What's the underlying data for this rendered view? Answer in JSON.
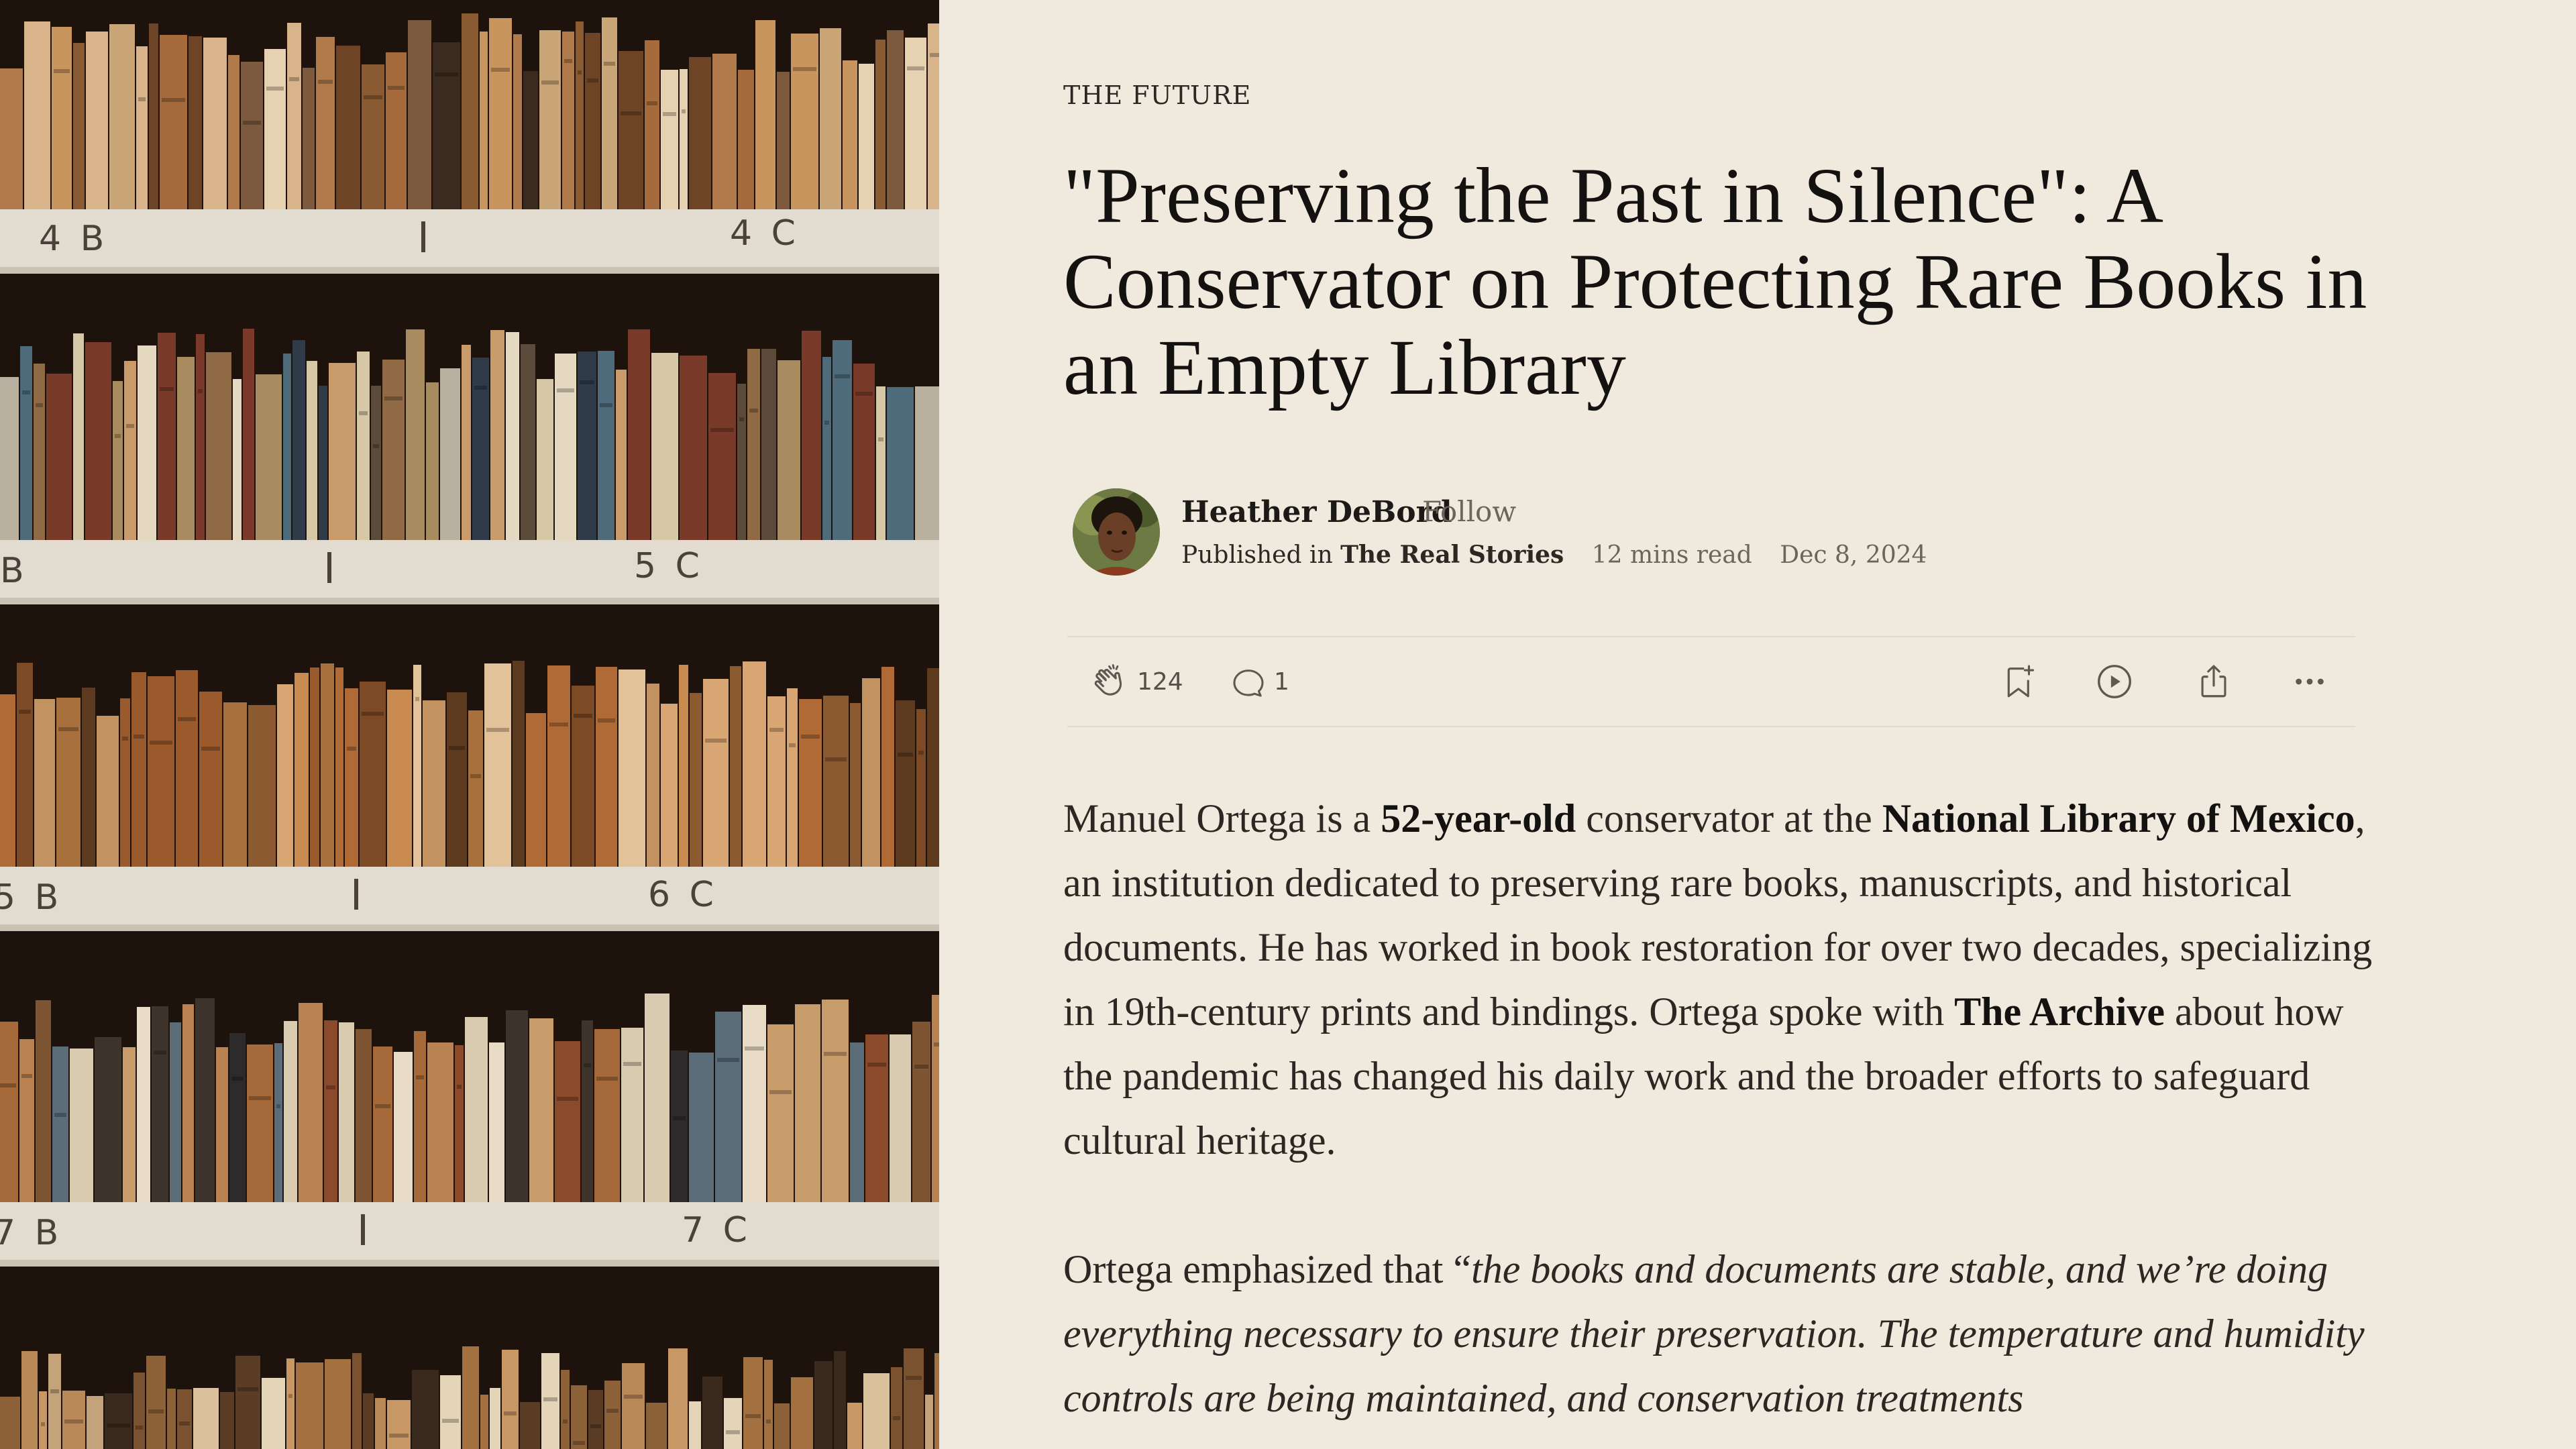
{
  "kicker": "THE FUTURE",
  "headline": "\"Preserving the Past in Silence\": A Conservator on Protecting Rare Books in an Empty Library",
  "author": {
    "name": "Heather DeBord",
    "follow_label": "Follow",
    "published_prefix": "Published in",
    "publication": "The Real Stories",
    "read_time": "12 mins read",
    "date": "Dec 8, 2024"
  },
  "actions": {
    "clap_icon": "clap-icon",
    "clap_count": "124",
    "comment_icon": "comment-icon",
    "comment_count": "1",
    "bookmark_icon": "bookmark-add-icon",
    "listen_icon": "play-icon",
    "share_icon": "share-icon",
    "more_icon": "more-icon"
  },
  "photo": {
    "shelf_labels": [
      "4 B",
      "4 C",
      "B",
      "5 C",
      "5 B",
      "6 C",
      "7 B",
      "7 C"
    ]
  },
  "body": {
    "p1": {
      "t1": "Manuel Ortega is a ",
      "b1": "52-year-old",
      "t2": " conservator at the ",
      "b2": "National Library of Mexico",
      "t3": ", an institution dedicated to preserving rare books, manuscripts, and historical documents. He has worked in book restoration for over two decades, specializing in 19th-century prints and bindings. Ortega spoke with ",
      "b3": "The Archive",
      "t4": " about how the pandemic has changed his daily work and the broader efforts to safeguard cultural heritage."
    },
    "p2": {
      "t1": "Ortega emphasized that “",
      "i1": "the books and documents are stable, and we’re doing everything necessary to ensure their preservation. The temperature and humidity controls are being maintained, and conservation treatments"
    }
  },
  "colors": {
    "page_bg": "#f0e9de",
    "text": "#1c1a17",
    "muted": "#6b655d",
    "divider": "#e2dacd"
  }
}
